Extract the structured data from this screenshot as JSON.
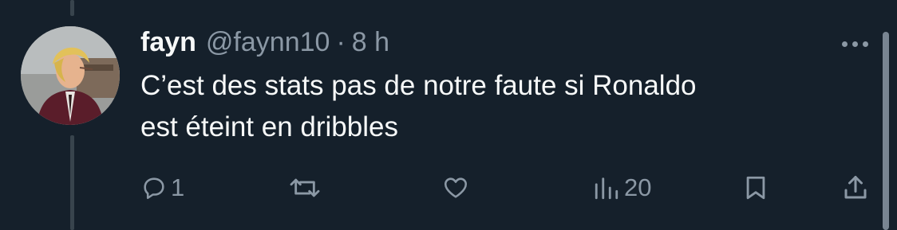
{
  "tweet": {
    "author": {
      "display_name": "fayn",
      "handle": "@faynn10",
      "avatar_icon": "profile-avatar-icon"
    },
    "separator": "·",
    "time": "8 h",
    "text_line1": "C’est des stats pas de notre faute si Ronaldo",
    "text_line2": "est éteint en dribbles",
    "actions": {
      "reply": {
        "icon": "reply-icon",
        "count": "1"
      },
      "retweet": {
        "icon": "retweet-icon",
        "count": ""
      },
      "like": {
        "icon": "heart-icon",
        "count": ""
      },
      "views": {
        "icon": "views-icon",
        "count": "20"
      },
      "bookmark": {
        "icon": "bookmark-icon"
      },
      "share": {
        "icon": "share-icon"
      }
    }
  },
  "colors": {
    "background": "#15202b",
    "primary_text": "#f7f9f9",
    "secondary_text": "#8b98a5",
    "thread_line": "#38444d"
  }
}
